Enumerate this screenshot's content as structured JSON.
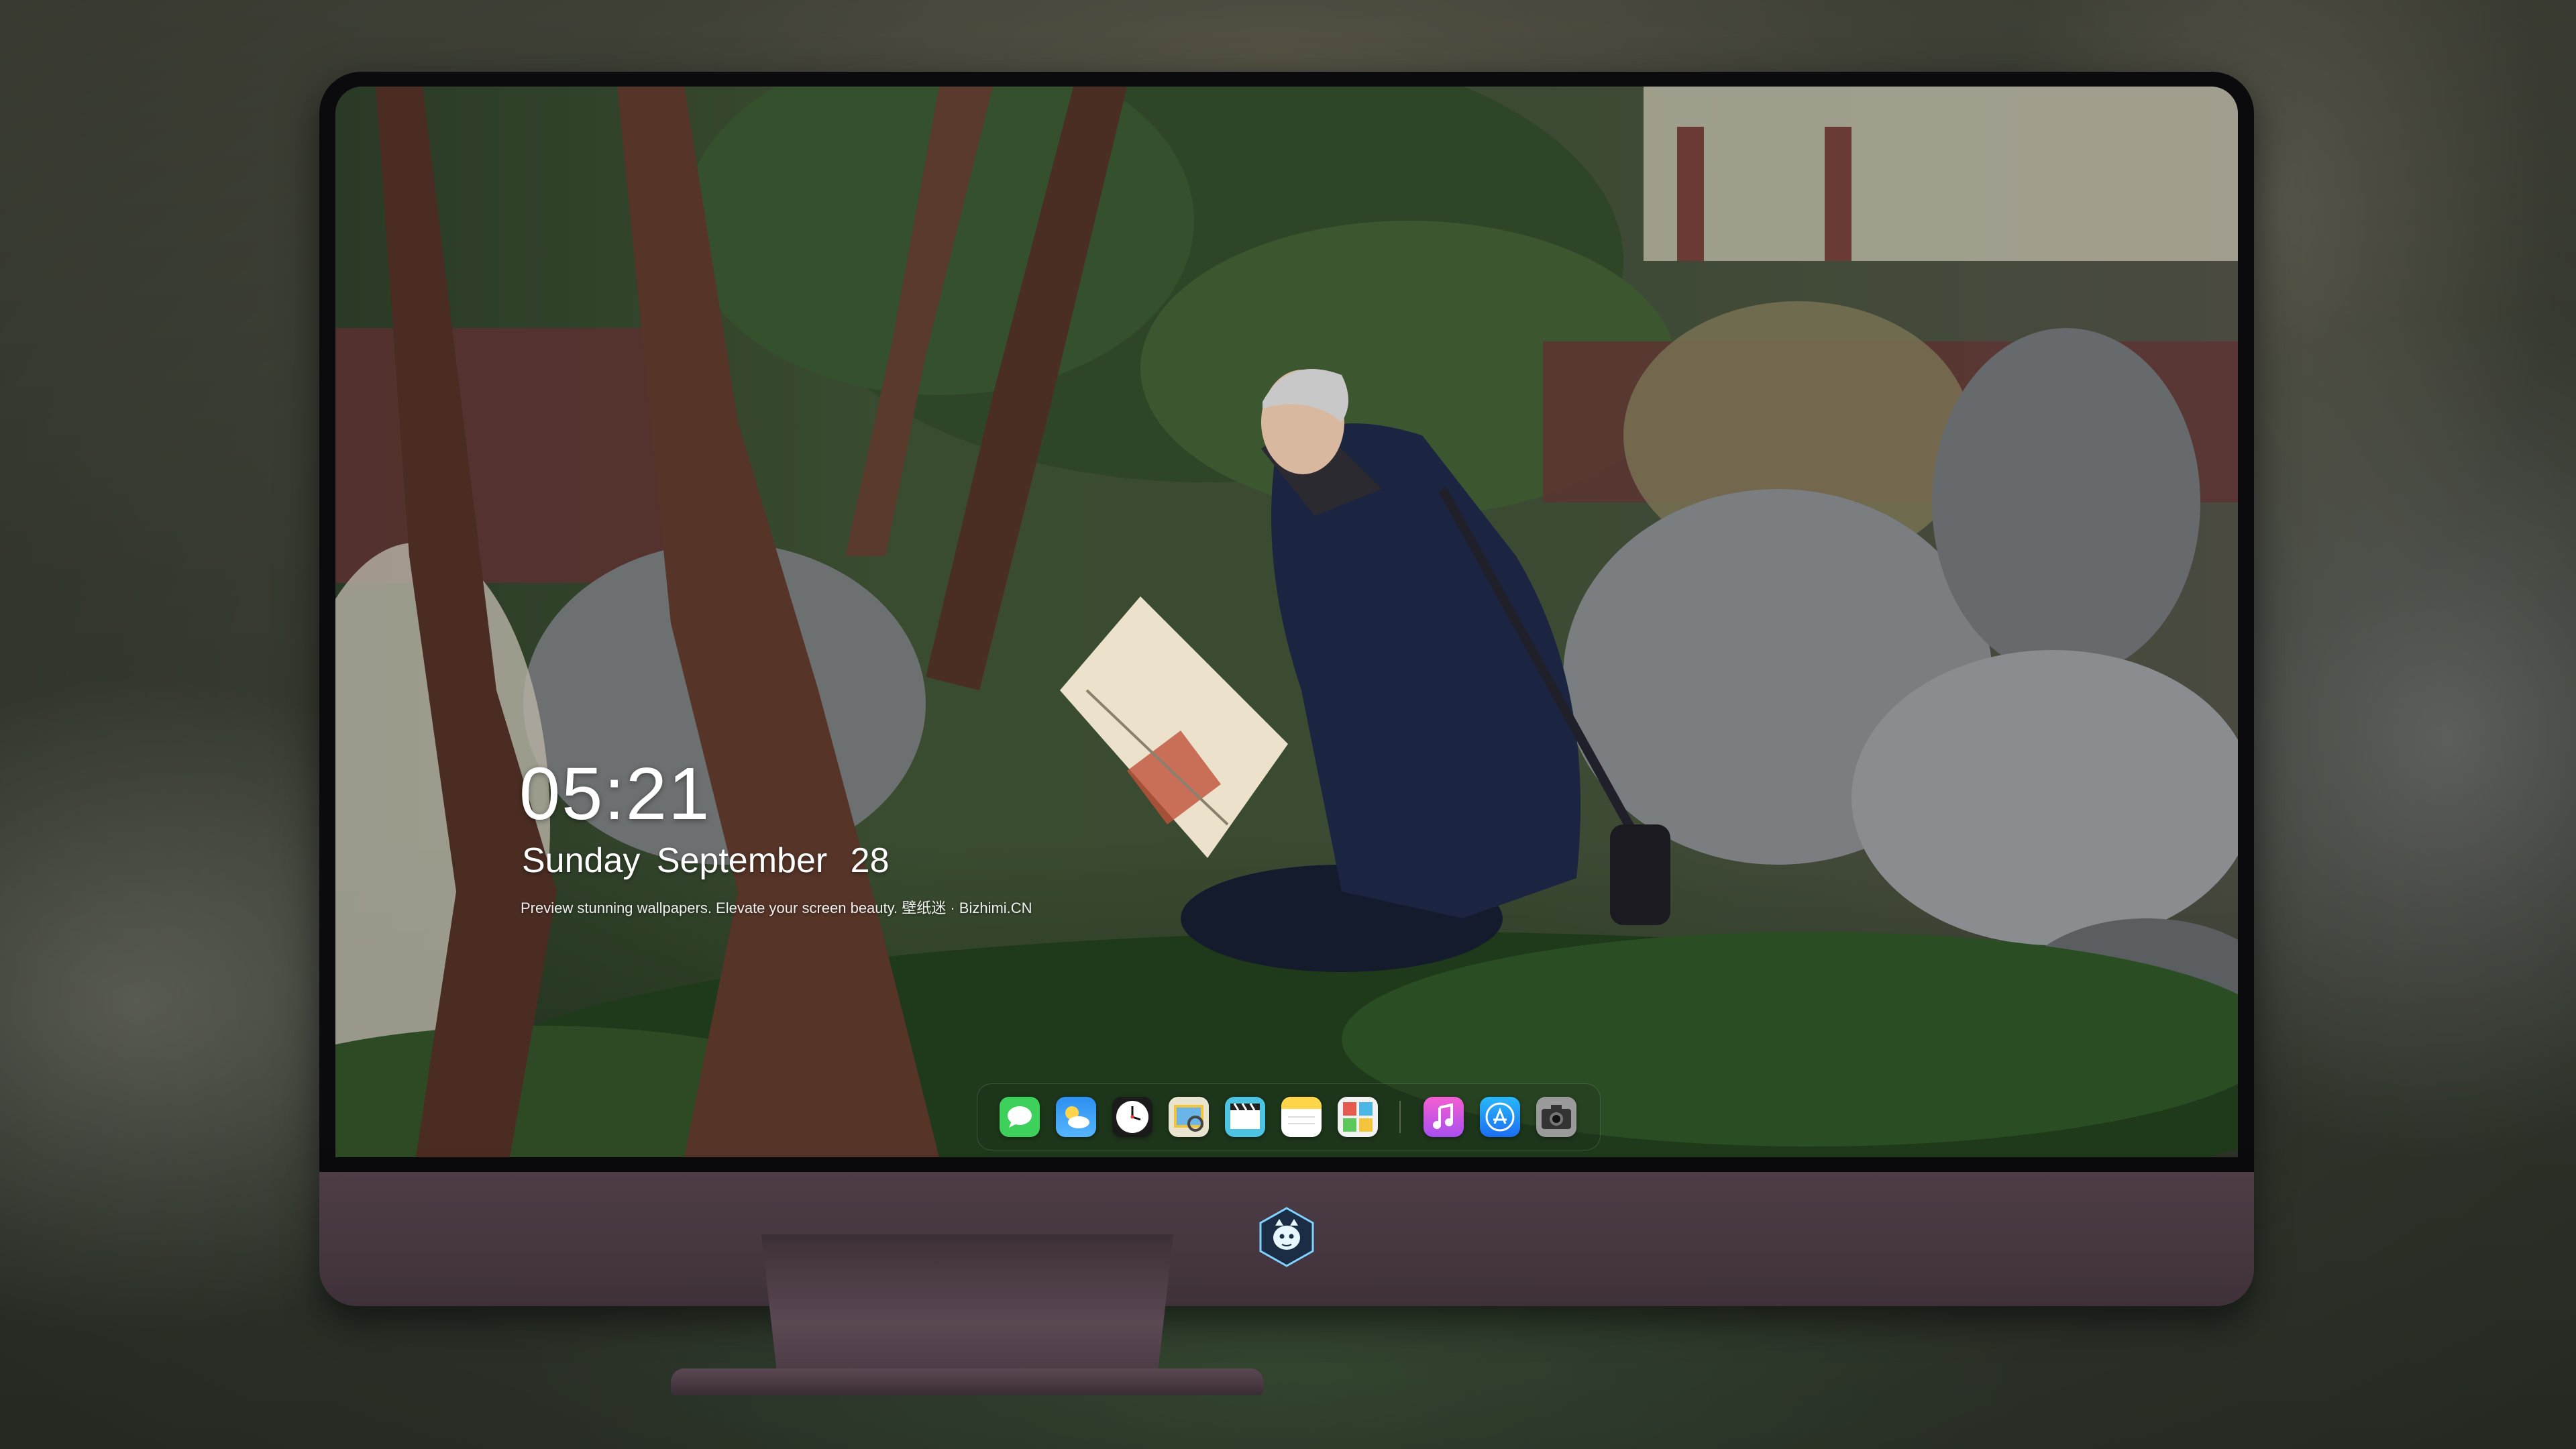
{
  "lockscreen": {
    "time": "05:21",
    "weekday": "Sunday",
    "month": "September",
    "day": "28",
    "caption": "Preview stunning wallpapers. Elevate your screen beauty. 壁纸迷 · Bizhimi.CN"
  },
  "dock": {
    "items": [
      {
        "name": "messages-icon",
        "color": "#3dd05a"
      },
      {
        "name": "weather-icon",
        "color": "#2d8ff0"
      },
      {
        "name": "clock-icon",
        "color": "#ffffff"
      },
      {
        "name": "preview-icon",
        "color": "#f2c53d"
      },
      {
        "name": "video-icon",
        "color": "#4cc3e0"
      },
      {
        "name": "notes-icon",
        "color": "#ffd54a"
      },
      {
        "name": "photo-booth-icon",
        "color": "#e55b4d"
      },
      {
        "name": "music-icon",
        "color": "#e04fd6"
      },
      {
        "name": "app-store-icon",
        "color": "#1c8ef9"
      },
      {
        "name": "camera-icon",
        "color": "#8a8a8a"
      }
    ]
  },
  "colors": {
    "chin": "#4e3d46",
    "bezel": "#0b0b0d",
    "text": "#ffffff"
  }
}
